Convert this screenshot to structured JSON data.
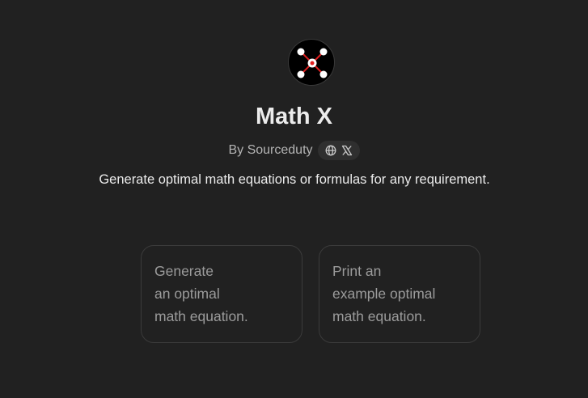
{
  "gpt": {
    "name": "Math X",
    "byline": "By Sourceduty",
    "description": "Generate optimal math equations or formulas for any requirement."
  },
  "social": {
    "icons": [
      "globe-icon",
      "x-logo-icon"
    ]
  },
  "starters": [
    {
      "lines": [
        "Generate",
        "an optimal",
        "math equation."
      ]
    },
    {
      "lines": [
        "Print an",
        "example optimal",
        "math equation."
      ]
    }
  ],
  "colors": {
    "background": "#212121",
    "card_border": "#3b3b3b",
    "logo_accent": "#e02020"
  }
}
